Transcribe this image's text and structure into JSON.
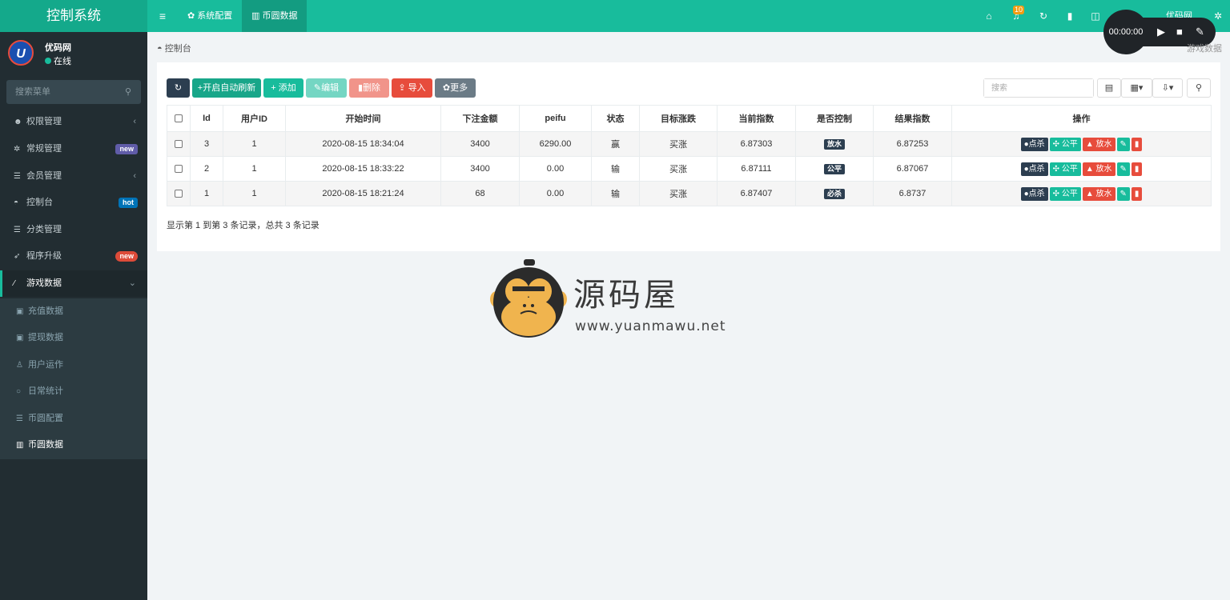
{
  "app": {
    "title": "控制系统"
  },
  "topbar": {
    "tabs": [
      {
        "label": "系统配置"
      },
      {
        "label": "币圆数据"
      }
    ],
    "notification_count": "10",
    "user_name": "优码网"
  },
  "recorder": {
    "time": "00:00:00"
  },
  "sidebar": {
    "user": {
      "name": "优码网",
      "status": "在线",
      "avatar_letter": "U"
    },
    "search_placeholder": "搜索菜单",
    "items": [
      {
        "label": "权限管理",
        "icon": "users-icon"
      },
      {
        "label": "常规管理",
        "icon": "cogs-icon",
        "badge": "new",
        "badge_color": "#605ca8"
      },
      {
        "label": "会员管理",
        "icon": "list-icon"
      },
      {
        "label": "控制台",
        "icon": "dashboard-icon",
        "badge": "hot",
        "badge_color": "#0073b7"
      },
      {
        "label": "分类管理",
        "icon": "list-icon"
      },
      {
        "label": "程序升级",
        "icon": "rocket-icon",
        "badge": "new",
        "badge_color": "#dd4b39"
      },
      {
        "label": "游戏数据",
        "icon": "magic-icon"
      }
    ],
    "subitems": [
      {
        "label": "充值数据",
        "icon": "money-icon"
      },
      {
        "label": "提现数据",
        "icon": "money-icon"
      },
      {
        "label": "用户运作",
        "icon": "user-icon"
      },
      {
        "label": "日常统计",
        "icon": "circle-icon"
      },
      {
        "label": "币圆配置",
        "icon": "list-icon"
      },
      {
        "label": "币圆数据",
        "icon": "chart-icon"
      }
    ]
  },
  "breadcrumb": {
    "label": "控制台",
    "right": "游戏数据"
  },
  "toolbar": {
    "refresh_label": "",
    "auto_refresh_label": "开启自动刷新",
    "add_label": "添加",
    "edit_label": "编辑",
    "delete_label": "删除",
    "import_label": "导入",
    "more_label": "更多",
    "search_placeholder": "搜索",
    "colors": {
      "dark": "#2c3e50",
      "primary": "#18bc9c",
      "danger": "#e74c3c",
      "gray": "#95a5a6"
    }
  },
  "table": {
    "columns": [
      "Id",
      "用户ID",
      "开始时间",
      "下注金额",
      "peifu",
      "状态",
      "目标涨跌",
      "当前指数",
      "是否控制",
      "结果指数",
      "操作"
    ],
    "rows": [
      {
        "id": "3",
        "user_id": "1",
        "start_time": "2020-08-15 18:34:04",
        "bet": "3400",
        "peifu": "6290.00",
        "status": "赢",
        "target": "买涨",
        "current": "6.87303",
        "control": "放水",
        "result": "6.87253"
      },
      {
        "id": "2",
        "user_id": "1",
        "start_time": "2020-08-15 18:33:22",
        "bet": "3400",
        "peifu": "0.00",
        "status": "输",
        "target": "买涨",
        "current": "6.87111",
        "control": "公平",
        "result": "6.87067"
      },
      {
        "id": "1",
        "user_id": "1",
        "start_time": "2020-08-15 18:21:24",
        "bet": "68",
        "peifu": "0.00",
        "status": "输",
        "target": "买涨",
        "current": "6.87407",
        "control": "必杀",
        "result": "6.8737"
      }
    ],
    "actions": {
      "kill": "点杀",
      "fair": "公平",
      "release": "放水"
    },
    "summary": "显示第 1 到第 3 条记录，总共 3 条记录"
  },
  "watermark": {
    "text": "源码屋",
    "url": "www.yuanmawu.net"
  }
}
